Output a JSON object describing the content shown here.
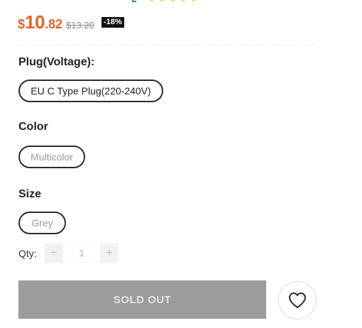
{
  "rating": {
    "stars": 5
  },
  "price": {
    "currency": "$",
    "integer": "10",
    "decimal": ".82",
    "original": "$13.20",
    "discount": "-18%"
  },
  "options": {
    "plug": {
      "title": "Plug(Voltage):",
      "value": "EU C Type Plug(220-240V)"
    },
    "color": {
      "title": "Color",
      "value": "Multicolor"
    },
    "size": {
      "title": "Size",
      "value": "Grey"
    }
  },
  "quantity": {
    "label": "Qty:",
    "minus": "−",
    "value": "1",
    "plus": "+"
  },
  "actions": {
    "sold_out_label": "SOLD OUT",
    "wishlist_icon": "heart-icon"
  },
  "colors": {
    "price": "#e8632b",
    "sold_out_bg": "#9c9c9c",
    "badge_bg": "#111111"
  }
}
